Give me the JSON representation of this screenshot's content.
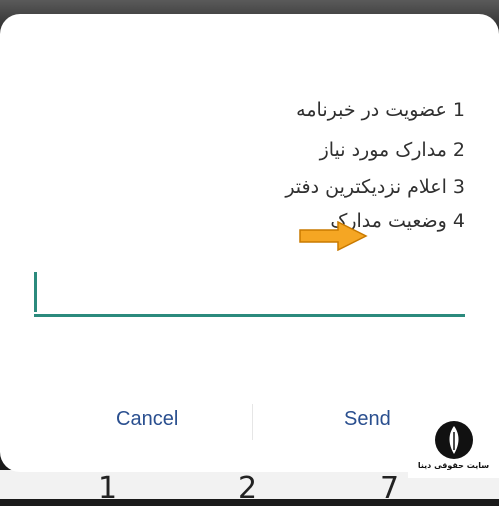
{
  "dialog": {
    "options": [
      {
        "text": "1 عضویت در خبرنامه"
      },
      {
        "text": "2 مدارک مورد نیاز"
      },
      {
        "text": "3 اعلام نزدیکترین دفتر"
      },
      {
        "text": "4 وضعیت مدارک"
      }
    ],
    "input": {
      "value": ""
    },
    "cancel_label": "Cancel",
    "send_label": "Send"
  },
  "keypad_peek": {
    "digits": [
      "1",
      "2",
      "7"
    ]
  },
  "watermark": {
    "text": "سایت حقوقی دینا"
  },
  "colors": {
    "accent": "#2b8a7d",
    "button_text": "#2a4f8f",
    "arrow_fill": "#f5a623",
    "arrow_stroke": "#c97a00"
  }
}
